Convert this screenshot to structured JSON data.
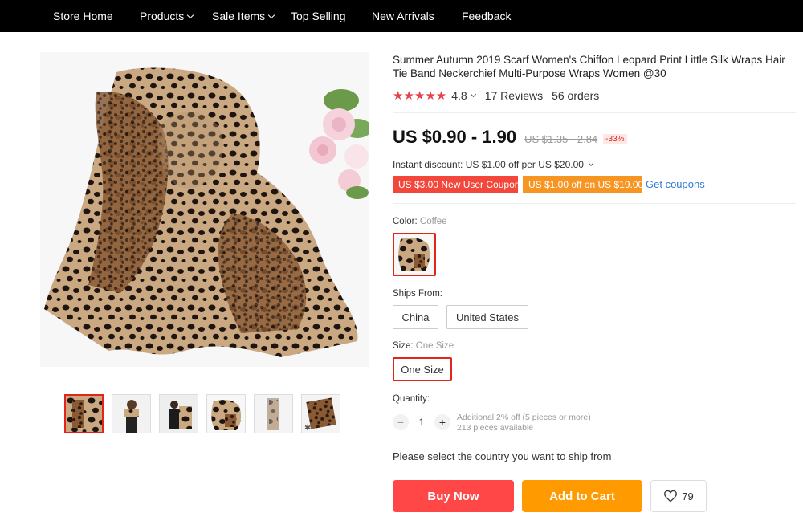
{
  "nav": {
    "items": [
      {
        "label": "Store Home",
        "dropdown": false
      },
      {
        "label": "Products",
        "dropdown": true
      },
      {
        "label": "Sale Items",
        "dropdown": true
      },
      {
        "label": "Top Selling",
        "dropdown": false
      },
      {
        "label": "New Arrivals",
        "dropdown": false
      },
      {
        "label": "Feedback",
        "dropdown": false
      }
    ]
  },
  "gallery": {
    "thumbnail_count": 6,
    "active_thumbnail": 1
  },
  "product": {
    "title": "Summer Autumn 2019 Scarf Women's Chiffon Leopard Print Little Silk Wraps Hair Tie Band Neckerchief Multi-Purpose Wraps Women @30",
    "rating": "4.8",
    "reviews": "17 Reviews",
    "orders": "56 orders",
    "price": "US $0.90 - 1.90",
    "original_price": "US $1.35 - 2.84",
    "discount": "-33%",
    "instant_discount": "Instant discount: US $1.00 off per US $20.00",
    "coupons": [
      "US $3.00 New User Coupon",
      "US $1.00 off on US $19.00"
    ],
    "get_coupons": "Get coupons"
  },
  "options": {
    "color_label": "Color:",
    "color_value": "Coffee",
    "ships_from_label": "Ships From:",
    "ships_from": [
      "China",
      "United States"
    ],
    "size_label": "Size:",
    "size_value": "One Size",
    "size_option": "One Size"
  },
  "quantity": {
    "label": "Quantity:",
    "minus": "−",
    "plus": "+",
    "value": "1",
    "note_line1": "Additional 2% off (5 pieces or more)",
    "note_line2": "213 pieces available"
  },
  "ship_message": "Please select the country you want to ship from",
  "actions": {
    "buy_now": "Buy Now",
    "add_to_cart": "Add to Cart",
    "wishlist_count": "79"
  },
  "colors": {
    "accent_red": "#ff4747",
    "accent_orange": "#ff9a00",
    "link_blue": "#2f7bd6",
    "star_red": "#e8414a"
  }
}
